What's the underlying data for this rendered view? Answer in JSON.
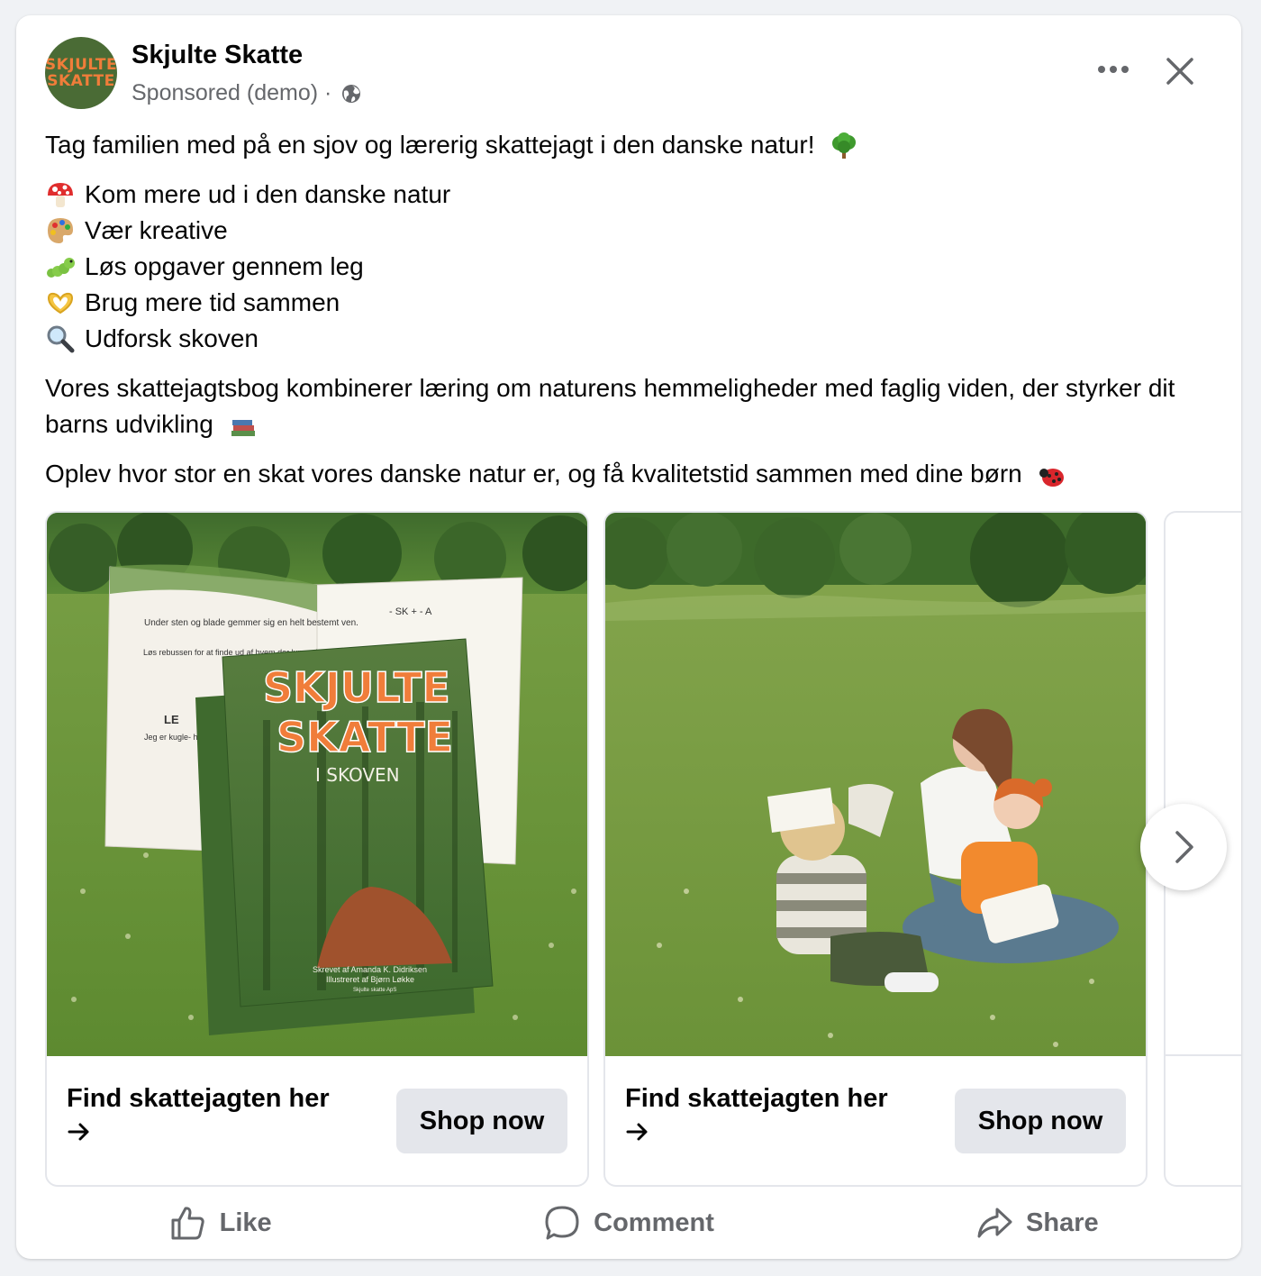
{
  "post": {
    "page_name": "Skjulte Skatte",
    "avatar_text_line1": "SKJULTE",
    "avatar_text_line2": "SKATTE",
    "sponsored_label": "Sponsored (demo) ·",
    "audience_icon": "globe-icon",
    "menu_icon": "more-horizontal-icon",
    "close_icon": "close-icon"
  },
  "body": {
    "intro": "Tag familien med på en sjov og lærerig skattejagt i den danske natur!",
    "intro_emoji": "tree-emoji",
    "bullets": [
      {
        "emoji": "mushroom-emoji",
        "text": "Kom mere ud i den danske natur"
      },
      {
        "emoji": "palette-emoji",
        "text": "Vær kreative"
      },
      {
        "emoji": "caterpillar-emoji",
        "text": "Løs opgaver gennem leg"
      },
      {
        "emoji": "heart-hands-emoji",
        "text": "Brug mere tid sammen"
      },
      {
        "emoji": "magnifier-emoji",
        "text": "Udforsk skoven"
      }
    ],
    "paragraph1": "Vores skattejagtsbog kombinerer læring om naturens hemmeligheder med faglig viden, der styrker dit barns udvikling",
    "paragraph1_emoji": "books-emoji",
    "paragraph2": "Oplev hvor stor en skat vores danske natur er, og få kvalitetstid sammen med dine børn",
    "paragraph2_emoji": "ladybug-emoji"
  },
  "carousel": {
    "cards": [
      {
        "image": "book-cover-on-grass",
        "cta_title": "Find skattejagten her",
        "button_label": "Shop now",
        "book": {
          "title_line1": "SKJULTE",
          "title_line2": "SKATTE",
          "subtitle": "I SKOVEN",
          "author": "Skrevet af Amanda K. Didriksen",
          "illustrator": "Illustreret af Bjørn Løkke",
          "publisher": "Skjulte skatte ApS",
          "inner_text_1": "Under sten og blade gemmer sig en helt bestemt ven.",
          "inner_text_2": "Løs rebussen for at finde ud af hvem der luner sig i skjulet",
          "inner_text_3": "Jeg er kugle- hvis jeg",
          "rebus": "- SK + - A",
          "le": "LE"
        }
      },
      {
        "image": "mother-and-children-reading-on-grass",
        "cta_title": "Find skattejagten her",
        "button_label": "Shop now"
      }
    ],
    "next_icon": "chevron-right-icon"
  },
  "actions": [
    {
      "icon": "like-icon",
      "label": "Like"
    },
    {
      "icon": "comment-icon",
      "label": "Comment"
    },
    {
      "icon": "share-icon",
      "label": "Share"
    }
  ]
}
